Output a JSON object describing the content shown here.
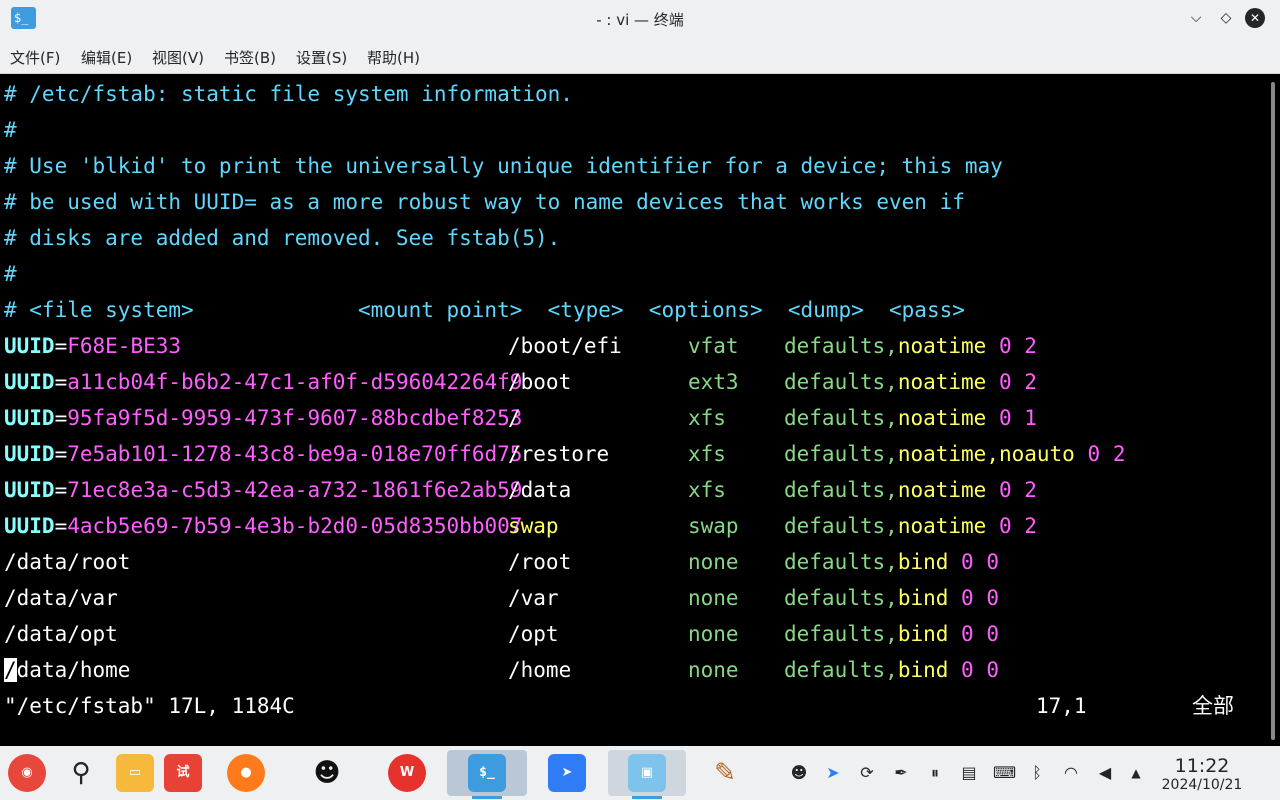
{
  "window": {
    "title": "- : vi — 终端",
    "app_icon_label": "$_"
  },
  "menu": [
    "文件(F)",
    "编辑(E)",
    "视图(V)",
    "书签(B)",
    "设置(S)",
    "帮助(H)"
  ],
  "comments": [
    "# /etc/fstab: static file system information.",
    "#",
    "# Use 'blkid' to print the universally unique identifier for a device; this may",
    "# be used with UUID= as a more robust way to name devices that works even if",
    "# disks are added and removed. See fstab(5).",
    "#",
    "# <file system>             <mount point>  <type>  <options>  <dump>  <pass>"
  ],
  "entries": [
    {
      "kw": "UUID",
      "eq": "=",
      "id": "F68E-BE33",
      "mount": "/boot/efi",
      "type": "vfat",
      "opt1": "defaults",
      "sep": ",",
      "opt2": "noatime",
      "opt3": "",
      "dump": "0",
      "pass": "2"
    },
    {
      "kw": "UUID",
      "eq": "=",
      "id": "a11cb04f-b6b2-47c1-af0f-d596042264f9",
      "mount": "/boot",
      "type": "ext3",
      "opt1": "defaults",
      "sep": ",",
      "opt2": "noatime",
      "opt3": "",
      "dump": "0",
      "pass": "2"
    },
    {
      "kw": "UUID",
      "eq": "=",
      "id": "95fa9f5d-9959-473f-9607-88bcdbef8253",
      "mount": "/",
      "type": "xfs",
      "opt1": "defaults",
      "sep": ",",
      "opt2": "noatime",
      "opt3": "",
      "dump": "0",
      "pass": "1"
    },
    {
      "kw": "UUID",
      "eq": "=",
      "id": "7e5ab101-1278-43c8-be9a-018e70ff6d75",
      "mount": "/restore",
      "type": "xfs",
      "opt1": "defaults",
      "sep": ",",
      "opt2": "noatime",
      "opt3": ",noauto",
      "dump": "0",
      "pass": "2"
    },
    {
      "kw": "UUID",
      "eq": "=",
      "id": "71ec8e3a-c5d3-42ea-a732-1861f6e2ab59",
      "mount": "/data",
      "type": "xfs",
      "opt1": "defaults",
      "sep": ",",
      "opt2": "noatime",
      "opt3": "",
      "dump": "0",
      "pass": "2"
    },
    {
      "kw": "UUID",
      "eq": "=",
      "id": "4acb5e69-7b59-4e3b-b2d0-05d8350bb007",
      "mount": "swap",
      "type": "swap",
      "opt1": "defaults",
      "sep": ",",
      "opt2": "noatime",
      "opt3": "",
      "dump": "0",
      "pass": "2"
    }
  ],
  "binds": [
    {
      "src": "/data/root",
      "mount": "/root",
      "type": "none",
      "opt1": "defaults",
      "sep": ",",
      "opt2": "bind",
      "dump": "0",
      "pass": "0"
    },
    {
      "src": "/data/var",
      "mount": "/var",
      "type": "none",
      "opt1": "defaults",
      "sep": ",",
      "opt2": "bind",
      "dump": "0",
      "pass": "0"
    },
    {
      "src": "/data/opt",
      "mount": "/opt",
      "type": "none",
      "opt1": "defaults",
      "sep": ",",
      "opt2": "bind",
      "dump": "0",
      "pass": "0"
    },
    {
      "src_cursor": "/",
      "src": "data/home",
      "mount": "/home",
      "type": "none",
      "opt1": "defaults",
      "sep": ",",
      "opt2": "bind",
      "dump": "0",
      "pass": "0"
    }
  ],
  "status": {
    "file": "\"/etc/fstab\" 17L, 1184C",
    "position": "17,1",
    "scroll": "全部"
  },
  "taskbar": {
    "apps": [
      "launcher",
      "search",
      "file-manager",
      "app-store",
      "firefox",
      "qq",
      "wps",
      "terminal",
      "feishu",
      "image-viewer",
      "paint"
    ],
    "terminal_label": "$_",
    "app_store_label": "试",
    "wps_label": "W",
    "clock_time": "11:22",
    "clock_date": "2024/10/21"
  }
}
